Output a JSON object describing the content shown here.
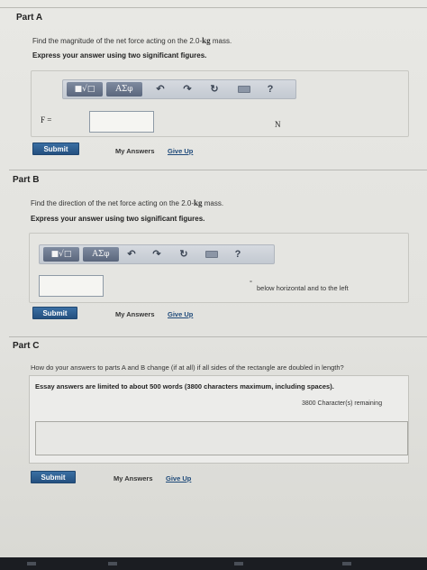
{
  "part_a": {
    "title": "Part A",
    "question": "Find the magnitude of the net force acting on the 2.0-",
    "question_unit": "kg",
    "question_end": " mass.",
    "instruction": "Express your answer using two significant figures.",
    "toolbar": {
      "templates_label": "■√□",
      "greek_label": "AΣφ",
      "help_label": "?"
    },
    "variable": "F =",
    "input_value": "",
    "unit": "N",
    "submit_label": "Submit",
    "my_answers_label": "My Answers",
    "give_up_label": "Give Up"
  },
  "part_b": {
    "title": "Part B",
    "question": "Find the direction of the net force acting on the 2.0-",
    "question_unit": "kg",
    "question_end": " mass.",
    "instruction": "Express your answer using two significant figures.",
    "toolbar": {
      "templates_label": "■√□",
      "greek_label": "AΣφ",
      "help_label": "?"
    },
    "input_value": "",
    "degree_symbol": "°",
    "suffix": "below horizontal and to the left",
    "submit_label": "Submit",
    "my_answers_label": "My Answers",
    "give_up_label": "Give Up"
  },
  "part_c": {
    "title": "Part C",
    "question": "How do your answers to parts A and B change (if at all) if all sides of the rectangle are doubled in length?",
    "essay_note": "Essay answers are limited to about 500 words (3800 characters maximum, including spaces).",
    "remaining": "3800 Character(s) remaining",
    "textarea_value": "",
    "submit_label": "Submit",
    "my_answers_label": "My Answers",
    "give_up_label": "Give Up"
  },
  "icons": [
    "undo-icon",
    "redo-icon",
    "reset-icon",
    "keyboard-icon",
    "help-icon"
  ]
}
